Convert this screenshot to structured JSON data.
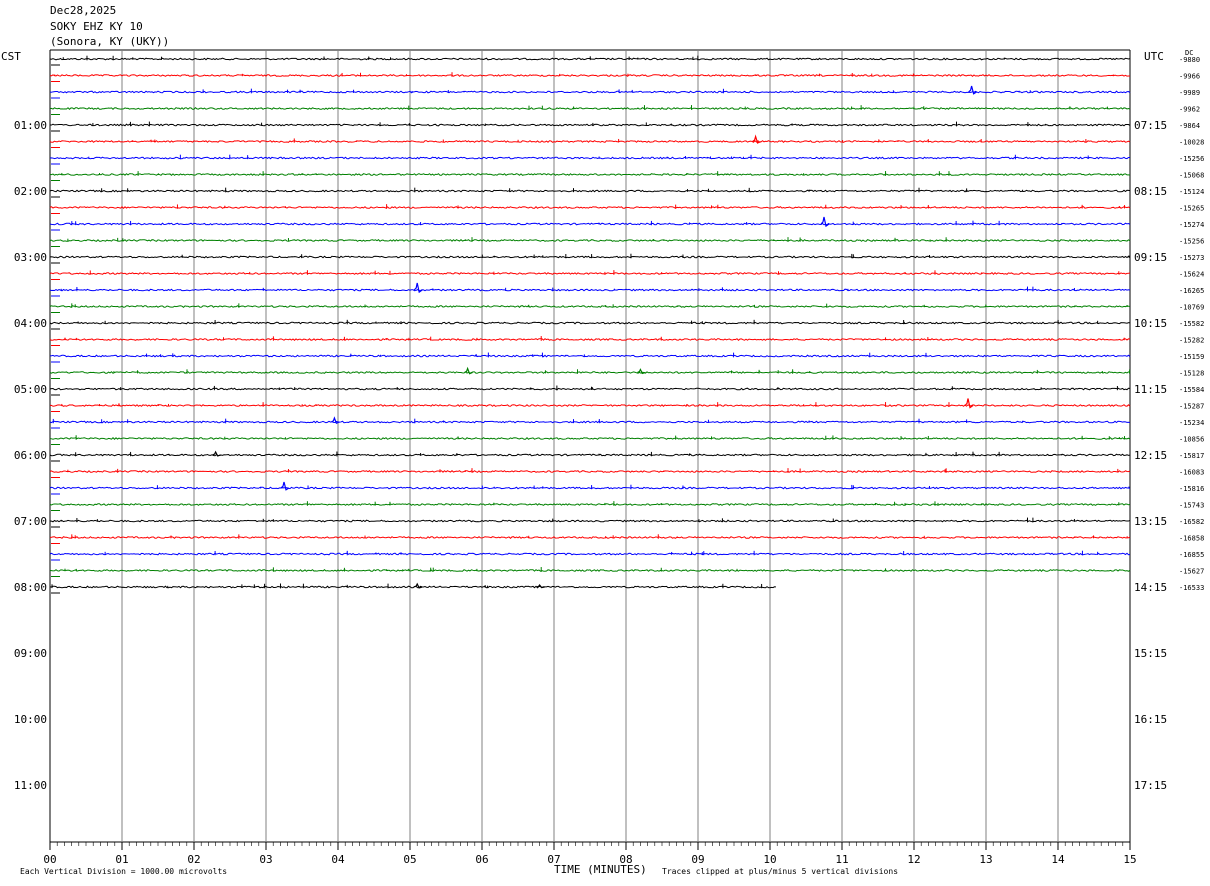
{
  "header": {
    "date": "Dec28,2025",
    "station": "SOKY EHZ KY 10",
    "location": "(Sonora, KY (UKY))",
    "left_tz": "CST",
    "right_tz": "UTC",
    "dc_label": "DC"
  },
  "chart_data": {
    "type": "line",
    "title": "",
    "xlabel": "TIME (MINUTES)",
    "ylabel": "",
    "xlim": [
      0,
      15
    ],
    "x_ticks": [
      "00",
      "01",
      "02",
      "03",
      "04",
      "05",
      "06",
      "07",
      "08",
      "09",
      "10",
      "11",
      "12",
      "13",
      "14",
      "15"
    ],
    "grid": true,
    "hour_labels_cst": [
      "01:00",
      "02:00",
      "03:00",
      "04:00",
      "05:00",
      "06:00",
      "07:00",
      "08:00",
      "09:00",
      "10:00",
      "11:00"
    ],
    "hour_labels_utc": [
      "07:15",
      "08:15",
      "09:15",
      "10:15",
      "11:15",
      "12:15",
      "13:15",
      "14:15",
      "15:15",
      "16:15",
      "17:15"
    ],
    "trace_colors": [
      "#000000",
      "#ff0000",
      "#0000ff",
      "#008000"
    ],
    "series": [
      {
        "start": "00:00",
        "dc": "-9880"
      },
      {
        "start": "00:15",
        "dc": "-9966"
      },
      {
        "start": "00:30",
        "dc": "-9989"
      },
      {
        "start": "00:45",
        "dc": "-9962"
      },
      {
        "start": "01:00",
        "dc": "-9864"
      },
      {
        "start": "01:15",
        "dc": "-10028"
      },
      {
        "start": "01:30",
        "dc": "-15256"
      },
      {
        "start": "01:45",
        "dc": "-15068"
      },
      {
        "start": "02:00",
        "dc": "-15124"
      },
      {
        "start": "02:15",
        "dc": "-15265"
      },
      {
        "start": "02:30",
        "dc": "-15274"
      },
      {
        "start": "02:45",
        "dc": "-15256"
      },
      {
        "start": "03:00",
        "dc": "-15273"
      },
      {
        "start": "03:15",
        "dc": "-15624"
      },
      {
        "start": "03:30",
        "dc": "-16265"
      },
      {
        "start": "03:45",
        "dc": "-10769"
      },
      {
        "start": "04:00",
        "dc": "-15582"
      },
      {
        "start": "04:15",
        "dc": "-15282"
      },
      {
        "start": "04:30",
        "dc": "-15159"
      },
      {
        "start": "04:45",
        "dc": "-15128"
      },
      {
        "start": "05:00",
        "dc": "-15584"
      },
      {
        "start": "05:15",
        "dc": "-15287"
      },
      {
        "start": "05:30",
        "dc": "-15234"
      },
      {
        "start": "05:45",
        "dc": "-10856"
      },
      {
        "start": "06:00",
        "dc": "-15817"
      },
      {
        "start": "06:15",
        "dc": "-16083"
      },
      {
        "start": "06:30",
        "dc": "-15816"
      },
      {
        "start": "06:45",
        "dc": "-15743"
      },
      {
        "start": "07:00",
        "dc": "-16582"
      },
      {
        "start": "07:15",
        "dc": "-16858"
      },
      {
        "start": "07:30",
        "dc": "-16855"
      },
      {
        "start": "07:45",
        "dc": "-15627"
      },
      {
        "start": "08:00",
        "dc": "-16533",
        "end_minute": 10.1
      }
    ],
    "events": [
      {
        "trace": 2,
        "minute": 12.8,
        "amp": -6
      },
      {
        "trace": 5,
        "minute": 9.8,
        "amp": -5
      },
      {
        "trace": 10,
        "minute": 10.75,
        "amp": -7
      },
      {
        "trace": 14,
        "minute": 5.1,
        "amp": -7
      },
      {
        "trace": 19,
        "minute": 5.8,
        "amp": -4
      },
      {
        "trace": 19,
        "minute": 8.2,
        "amp": -3
      },
      {
        "trace": 21,
        "minute": 12.75,
        "amp": -7
      },
      {
        "trace": 22,
        "minute": 3.95,
        "amp": -4
      },
      {
        "trace": 24,
        "minute": 2.3,
        "amp": -3
      },
      {
        "trace": 26,
        "minute": 3.25,
        "amp": -6
      },
      {
        "trace": 32,
        "minute": 5.1,
        "amp": -3
      },
      {
        "trace": 32,
        "minute": 6.8,
        "amp": -2
      }
    ]
  },
  "footer": {
    "scale_note": "Each Vertical Division = 1000.00 microvolts",
    "clip_note": "Traces clipped at plus/minus 5 vertical divisions"
  }
}
